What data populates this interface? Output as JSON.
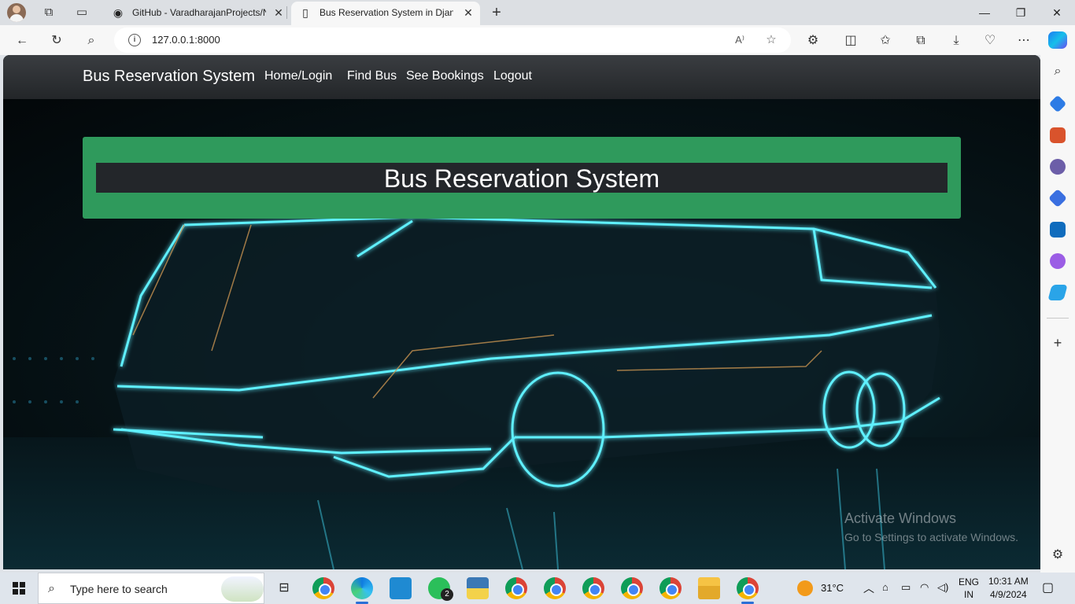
{
  "browser": {
    "tabs": [
      {
        "title": "GitHub - VaradharajanProjects/N",
        "icon": "github-icon",
        "active": false
      },
      {
        "title": "Bus Reservation System in Djang",
        "icon": "page-icon",
        "active": true
      }
    ],
    "address": {
      "url": "127.0.0.1:8000"
    }
  },
  "site": {
    "brand": "Bus Reservation System",
    "nav": [
      {
        "label": "Home/Login"
      },
      {
        "label": "Find Bus"
      },
      {
        "label": "See Bookings"
      },
      {
        "label": "Logout"
      }
    ],
    "hero_title": "Bus Reservation System",
    "colors": {
      "navbar": "#2c2f33",
      "banner": "#2f9a5c",
      "banner_inner": "#23262a",
      "neon": "#5ff0ff"
    }
  },
  "os_watermark": {
    "title": "Activate Windows",
    "subtitle": "Go to Settings to activate Windows."
  },
  "taskbar": {
    "search_placeholder": "Type here to search",
    "whatsapp_badge": "2",
    "weather": "31°C",
    "language": "ENG",
    "region": "IN",
    "time": "10:31 AM",
    "date": "4/9/2024"
  }
}
